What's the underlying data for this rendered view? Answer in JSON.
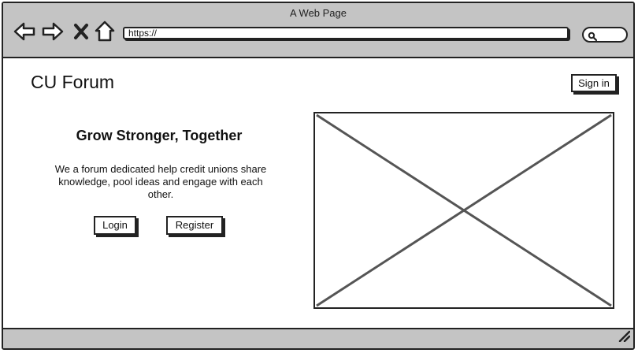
{
  "browser": {
    "window_title": "A Web Page",
    "url": "https://",
    "icons": [
      "back-arrow-icon",
      "forward-arrow-icon",
      "close-icon",
      "home-icon",
      "search-icon",
      "resize-grip-icon"
    ]
  },
  "header": {
    "logo": "CU Forum",
    "signin_label": "Sign in"
  },
  "hero": {
    "title": "Grow Stronger, Together",
    "description": "We a forum dedicated help credit unions share knowledge, pool ideas and engage with each other.",
    "login_label": "Login",
    "register_label": "Register"
  },
  "colors": {
    "chrome": "#c4c4c4",
    "outline": "#222222",
    "placeholder_stroke": "#555555",
    "background": "#ffffff"
  }
}
